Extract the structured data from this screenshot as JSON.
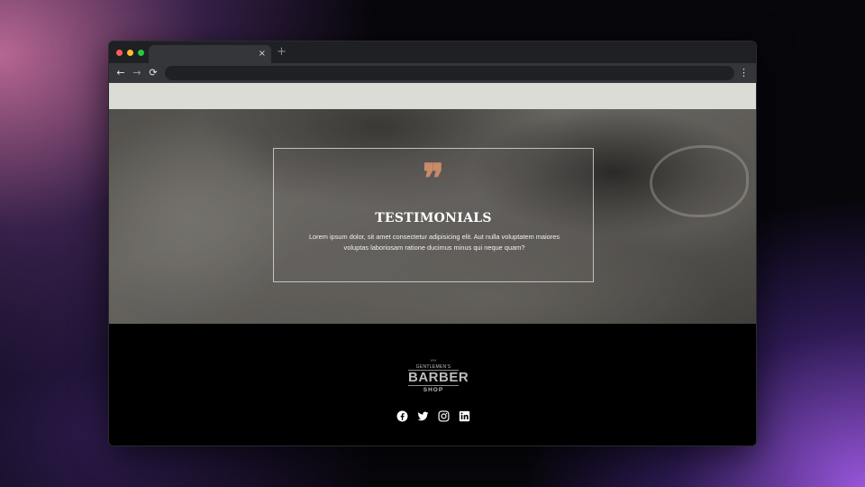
{
  "browser": {
    "tab_close": "×",
    "new_tab": "+",
    "back": "←",
    "forward": "→",
    "reload": "⟳",
    "menu": "⋮"
  },
  "testimonials": {
    "quote_mark": "❞",
    "title": "TESTIMONIALS",
    "text_line1": "Lorem ipsum dolor, sit amet consectetur adipisicing elit. Aut nulla voluptatem maiores",
    "text_line2": "voluptas laboriosam ratione ducimus minus qui neque quam?"
  },
  "footer": {
    "logo": {
      "top": "GENTLEMEN'S",
      "main": "BARBER",
      "bottom": "SHOP"
    },
    "social_icons": [
      "facebook-icon",
      "twitter-icon",
      "instagram-icon",
      "linkedin-icon"
    ]
  },
  "colors": {
    "accent_quote": "#c98a6a",
    "topbar": "#dcdcd7",
    "footer_bg": "#000000"
  }
}
